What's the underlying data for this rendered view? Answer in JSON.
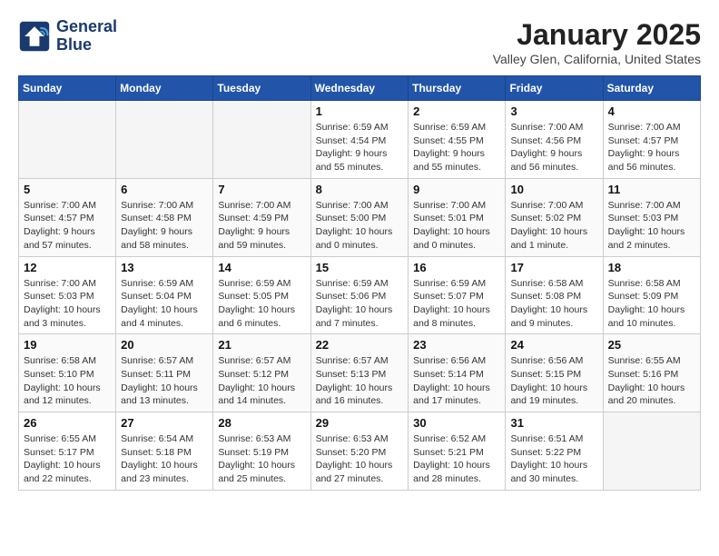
{
  "header": {
    "logo_line1": "General",
    "logo_line2": "Blue",
    "month": "January 2025",
    "location": "Valley Glen, California, United States"
  },
  "weekdays": [
    "Sunday",
    "Monday",
    "Tuesday",
    "Wednesday",
    "Thursday",
    "Friday",
    "Saturday"
  ],
  "weeks": [
    [
      {
        "day": "",
        "empty": true
      },
      {
        "day": "",
        "empty": true
      },
      {
        "day": "",
        "empty": true
      },
      {
        "day": "1",
        "sunrise": "6:59 AM",
        "sunset": "4:54 PM",
        "daylight": "9 hours and 55 minutes."
      },
      {
        "day": "2",
        "sunrise": "6:59 AM",
        "sunset": "4:55 PM",
        "daylight": "9 hours and 55 minutes."
      },
      {
        "day": "3",
        "sunrise": "7:00 AM",
        "sunset": "4:56 PM",
        "daylight": "9 hours and 56 minutes."
      },
      {
        "day": "4",
        "sunrise": "7:00 AM",
        "sunset": "4:57 PM",
        "daylight": "9 hours and 56 minutes."
      }
    ],
    [
      {
        "day": "5",
        "sunrise": "7:00 AM",
        "sunset": "4:57 PM",
        "daylight": "9 hours and 57 minutes."
      },
      {
        "day": "6",
        "sunrise": "7:00 AM",
        "sunset": "4:58 PM",
        "daylight": "9 hours and 58 minutes."
      },
      {
        "day": "7",
        "sunrise": "7:00 AM",
        "sunset": "4:59 PM",
        "daylight": "9 hours and 59 minutes."
      },
      {
        "day": "8",
        "sunrise": "7:00 AM",
        "sunset": "5:00 PM",
        "daylight": "10 hours and 0 minutes."
      },
      {
        "day": "9",
        "sunrise": "7:00 AM",
        "sunset": "5:01 PM",
        "daylight": "10 hours and 0 minutes."
      },
      {
        "day": "10",
        "sunrise": "7:00 AM",
        "sunset": "5:02 PM",
        "daylight": "10 hours and 1 minute."
      },
      {
        "day": "11",
        "sunrise": "7:00 AM",
        "sunset": "5:03 PM",
        "daylight": "10 hours and 2 minutes."
      }
    ],
    [
      {
        "day": "12",
        "sunrise": "7:00 AM",
        "sunset": "5:03 PM",
        "daylight": "10 hours and 3 minutes."
      },
      {
        "day": "13",
        "sunrise": "6:59 AM",
        "sunset": "5:04 PM",
        "daylight": "10 hours and 4 minutes."
      },
      {
        "day": "14",
        "sunrise": "6:59 AM",
        "sunset": "5:05 PM",
        "daylight": "10 hours and 6 minutes."
      },
      {
        "day": "15",
        "sunrise": "6:59 AM",
        "sunset": "5:06 PM",
        "daylight": "10 hours and 7 minutes."
      },
      {
        "day": "16",
        "sunrise": "6:59 AM",
        "sunset": "5:07 PM",
        "daylight": "10 hours and 8 minutes."
      },
      {
        "day": "17",
        "sunrise": "6:58 AM",
        "sunset": "5:08 PM",
        "daylight": "10 hours and 9 minutes."
      },
      {
        "day": "18",
        "sunrise": "6:58 AM",
        "sunset": "5:09 PM",
        "daylight": "10 hours and 10 minutes."
      }
    ],
    [
      {
        "day": "19",
        "sunrise": "6:58 AM",
        "sunset": "5:10 PM",
        "daylight": "10 hours and 12 minutes."
      },
      {
        "day": "20",
        "sunrise": "6:57 AM",
        "sunset": "5:11 PM",
        "daylight": "10 hours and 13 minutes."
      },
      {
        "day": "21",
        "sunrise": "6:57 AM",
        "sunset": "5:12 PM",
        "daylight": "10 hours and 14 minutes."
      },
      {
        "day": "22",
        "sunrise": "6:57 AM",
        "sunset": "5:13 PM",
        "daylight": "10 hours and 16 minutes."
      },
      {
        "day": "23",
        "sunrise": "6:56 AM",
        "sunset": "5:14 PM",
        "daylight": "10 hours and 17 minutes."
      },
      {
        "day": "24",
        "sunrise": "6:56 AM",
        "sunset": "5:15 PM",
        "daylight": "10 hours and 19 minutes."
      },
      {
        "day": "25",
        "sunrise": "6:55 AM",
        "sunset": "5:16 PM",
        "daylight": "10 hours and 20 minutes."
      }
    ],
    [
      {
        "day": "26",
        "sunrise": "6:55 AM",
        "sunset": "5:17 PM",
        "daylight": "10 hours and 22 minutes."
      },
      {
        "day": "27",
        "sunrise": "6:54 AM",
        "sunset": "5:18 PM",
        "daylight": "10 hours and 23 minutes."
      },
      {
        "day": "28",
        "sunrise": "6:53 AM",
        "sunset": "5:19 PM",
        "daylight": "10 hours and 25 minutes."
      },
      {
        "day": "29",
        "sunrise": "6:53 AM",
        "sunset": "5:20 PM",
        "daylight": "10 hours and 27 minutes."
      },
      {
        "day": "30",
        "sunrise": "6:52 AM",
        "sunset": "5:21 PM",
        "daylight": "10 hours and 28 minutes."
      },
      {
        "day": "31",
        "sunrise": "6:51 AM",
        "sunset": "5:22 PM",
        "daylight": "10 hours and 30 minutes."
      },
      {
        "day": "",
        "empty": true
      }
    ]
  ]
}
